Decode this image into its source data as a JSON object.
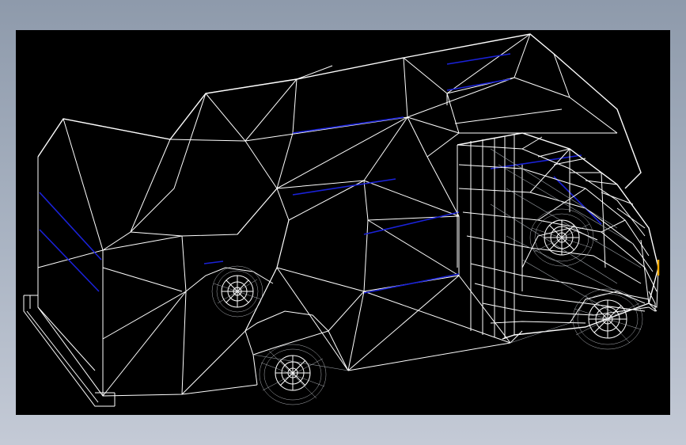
{
  "canvas": {
    "background": "#000000",
    "frame_background": "#a4aebd"
  },
  "model": {
    "type": "wireframe-3d",
    "subject": "rv-camper-motorhome",
    "colors": {
      "edges": "#ffffff",
      "window_edges": "#1a22d8",
      "marker": "#f2a900",
      "wheel_mesh": "#bfc3c8"
    }
  }
}
